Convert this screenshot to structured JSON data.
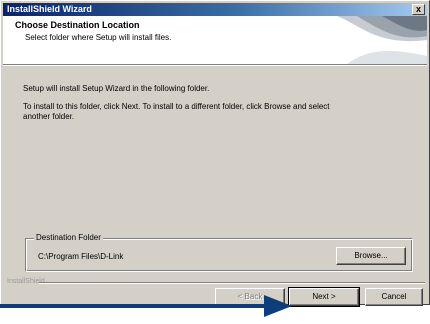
{
  "window": {
    "title": "InstallShield Wizard",
    "close_label": "x"
  },
  "header": {
    "title": "Choose Destination Location",
    "subtitle": "Select folder where Setup will install files."
  },
  "body": {
    "line1": "Setup will install Setup Wizard in the following folder.",
    "line2a": "To install to this folder, click Next. To install to a different folder, click Browse and select",
    "line2b": "another folder."
  },
  "destination": {
    "group_label": "Destination Folder",
    "path": "C:\\Program Files\\D-Link",
    "browse_label": "Browse..."
  },
  "footer": {
    "brand": "InstallShield",
    "back_label": "< Back",
    "next_label": "Next >",
    "cancel_label": "Cancel"
  },
  "icons": [
    "close-icon",
    "arrow-pointer-icon"
  ],
  "colors": {
    "titlebar_start": "#0a246a",
    "titlebar_end": "#a6caf0",
    "arrow": "#0d3d7a"
  }
}
